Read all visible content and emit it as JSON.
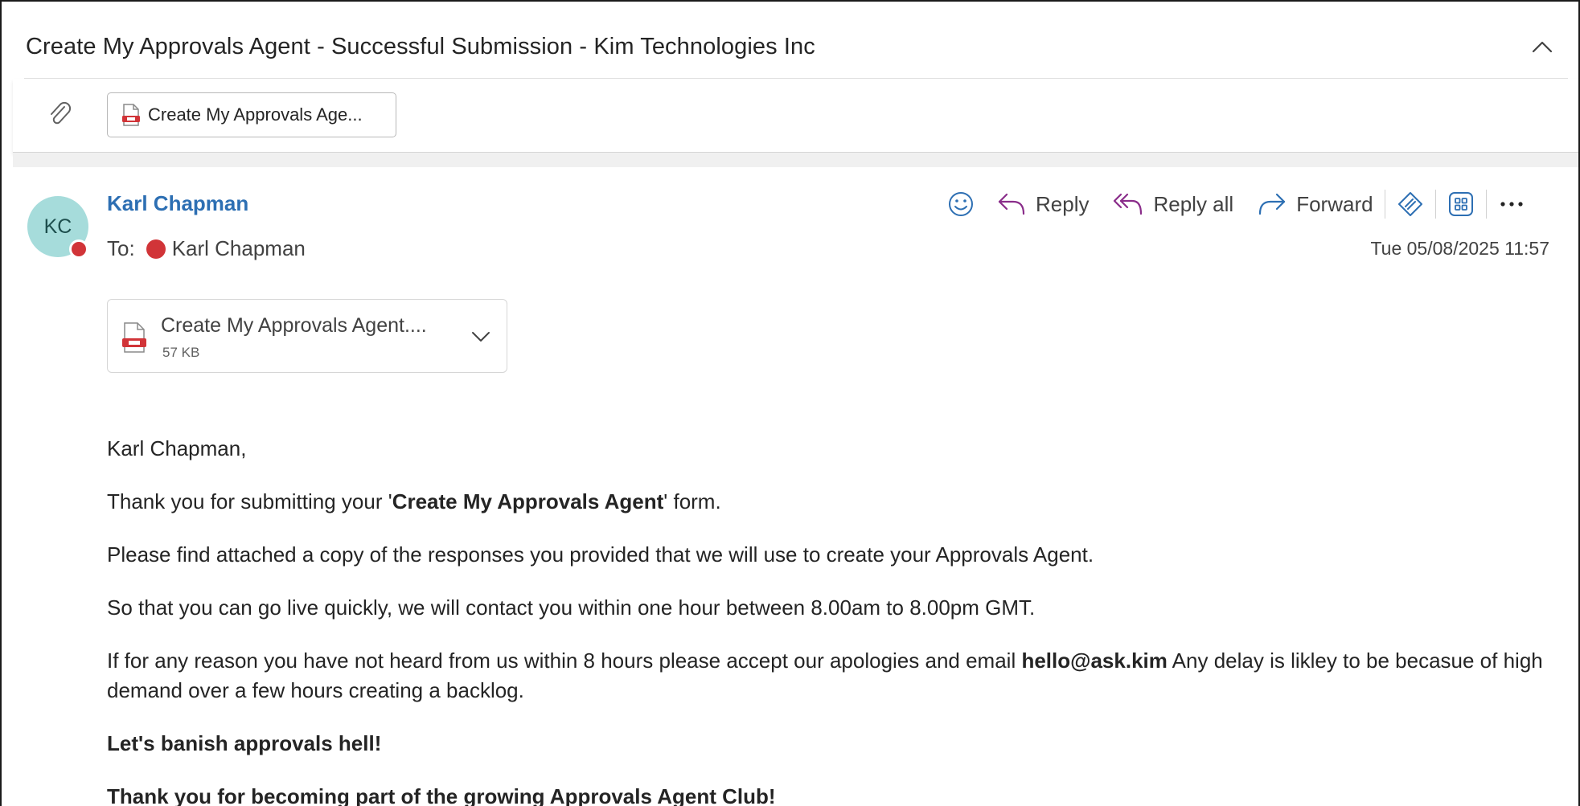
{
  "email": {
    "subject": "Create My Approvals Agent - Successful Submission - Kim Technologies Inc",
    "attachment_chip_label": "Create My Approvals Age...",
    "sender_initials": "KC",
    "sender_name": "Karl Chapman",
    "to_label": "To:",
    "to_name": "Karl Chapman",
    "timestamp": "Tue 05/08/2025 11:57",
    "attachment": {
      "name": "Create My Approvals Agent....",
      "size": "57 KB"
    }
  },
  "actions": {
    "reply": "Reply",
    "reply_all": "Reply all",
    "forward": "Forward"
  },
  "body": {
    "greeting": "Karl Chapman,",
    "p1_pre": "Thank you for submitting your '",
    "p1_bold": "Create My Approvals Agent",
    "p1_post": "' form.",
    "p2": "Please find attached a copy of the responses you provided that we will use to create your Approvals Agent.",
    "p3": "So that you can go live quickly, we will contact you within one hour between 8.00am to 8.00pm GMT.",
    "p4_pre": "If for any reason you have not heard from us within 8 hours please accept our apologies and email ",
    "p4_bold": "hello@ask.kim",
    "p4_post": " Any delay is likley to be becasue of high demand over a few hours creating a backlog.",
    "p5": "Let's banish approvals hell!",
    "p6": "Thank you for becoming part of the growing Approvals Agent Club!"
  },
  "colors": {
    "accent": "#2d6fb3",
    "reply_icon": "#8a2d8a",
    "presence": "#d13438",
    "avatar_bg": "#a6dcdb"
  },
  "icons": [
    "chevron-up-icon",
    "paperclip-icon",
    "pdf-icon",
    "emoji-icon",
    "reply-icon",
    "reply-all-icon",
    "forward-icon",
    "copilot-icon",
    "apps-icon",
    "more-icon",
    "chevron-down-icon"
  ]
}
